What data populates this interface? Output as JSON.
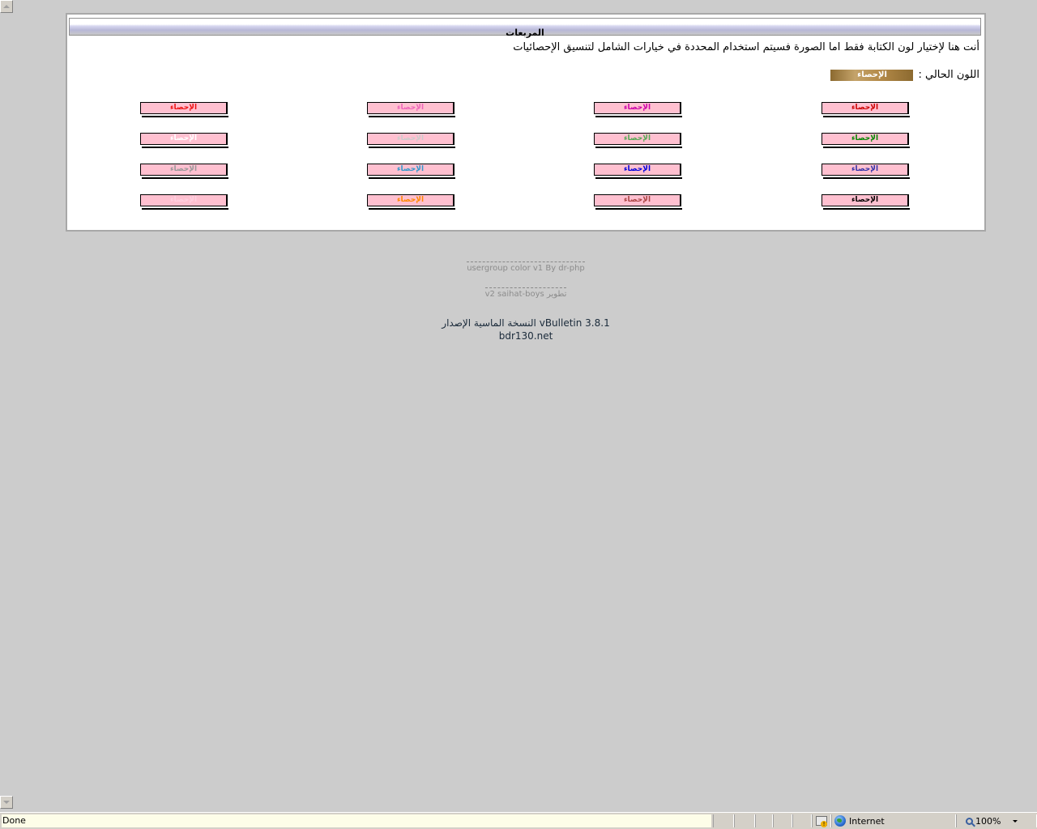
{
  "panel": {
    "title": "المربعات",
    "description": "أنت هنا لإختيار لون الكتابة فقط اما الصورة فسيتم استخدام المحددة في خيارات الشامل لتنسيق الإحصائيات",
    "current_label": "اللون الحالي :",
    "current_value": "الإحصاء"
  },
  "swatches": [
    {
      "label": "الإحصاء",
      "color": "#cc0000"
    },
    {
      "label": "الإحصاء",
      "color": "#cc00aa"
    },
    {
      "label": "الإحصاء",
      "color": "#ee66bb"
    },
    {
      "label": "الإحصاء",
      "color": "#ee1111"
    },
    {
      "label": "الإحصاء",
      "color": "#008800"
    },
    {
      "label": "الإحصاء",
      "color": "#55aa55"
    },
    {
      "label": "الإحصاء",
      "color": "#cccccc"
    },
    {
      "label": "الإحصاء",
      "color": "#ffffff"
    },
    {
      "label": "الإحصاء",
      "color": "#3333aa"
    },
    {
      "label": "الإحصاء",
      "color": "#0000dd"
    },
    {
      "label": "الإحصاء",
      "color": "#3399cc"
    },
    {
      "label": "الإحصاء",
      "color": "#999999"
    },
    {
      "label": "الإحصاء",
      "color": "#000000"
    },
    {
      "label": "الإحصاء",
      "color": "#aa4444"
    },
    {
      "label": "الإحصاء",
      "color": "#ff8800"
    },
    {
      "label": "الإحصاء",
      "color": "#ffd0e0"
    }
  ],
  "credits": {
    "line1": "usergroup color v1 By dr-php",
    "line2": "v2 saihat-boys تطوير",
    "version": "النسخة الماسية الإصدار vBulletin 3.8.1",
    "site": "bdr130.net"
  },
  "statusbar": {
    "status": "Done",
    "zone": "Internet",
    "zoom": "100%"
  },
  "icons": [
    "scroll-up-icon",
    "scroll-down-icon",
    "globe-icon",
    "protected-mode-icon",
    "zoom-icon",
    "dropdown-arrow-icon"
  ]
}
